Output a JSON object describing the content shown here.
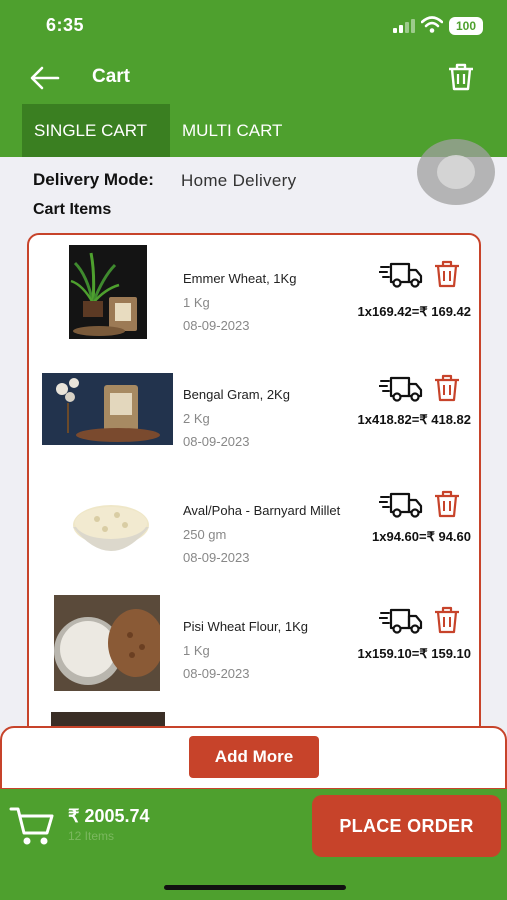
{
  "status_bar": {
    "time": "6:35",
    "battery": "100"
  },
  "header": {
    "title": "Cart"
  },
  "tabs": [
    {
      "label": "SINGLE CART",
      "active": true
    },
    {
      "label": "MULTI CART",
      "active": false
    }
  ],
  "delivery": {
    "label": "Delivery Mode:",
    "value": "Home Delivery"
  },
  "cart_items_label": "Cart Items",
  "items": [
    {
      "name": "Emmer Wheat, 1Kg",
      "qty": "1 Kg",
      "date": "08-09-2023",
      "price": "1x169.42=₹ 169.42",
      "image": "emmer-wheat-product-photo"
    },
    {
      "name": "Bengal Gram, 2Kg",
      "qty": "2 Kg",
      "date": "08-09-2023",
      "price": "1x418.82=₹ 418.82",
      "image": "bengal-gram-product-photo"
    },
    {
      "name": "Aval/Poha - Barnyard Millet",
      "qty": "250 gm",
      "date": "08-09-2023",
      "price": "1x94.60=₹ 94.60",
      "image": "poha-bowl-product-photo"
    },
    {
      "name": "Pisi Wheat Flour, 1Kg",
      "qty": "1 Kg",
      "date": "08-09-2023",
      "price": "1x159.10=₹ 159.10",
      "image": "wheat-flour-product-photo"
    }
  ],
  "add_more_label": "Add More",
  "footer": {
    "total": "₹ 2005.74",
    "item_count": "12 Items",
    "place_order_label": "PLACE ORDER"
  },
  "colors": {
    "brand_green": "#4ea02e",
    "active_tab": "#3a7f21",
    "accent_red": "#c7432a"
  }
}
